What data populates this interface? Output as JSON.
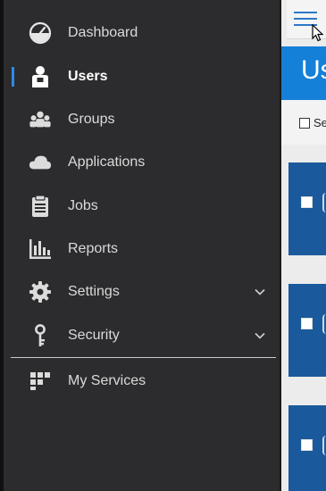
{
  "sidebar": {
    "items": [
      {
        "label": "Dashboard",
        "icon": "dashboard-icon"
      },
      {
        "label": "Users",
        "icon": "user-icon",
        "active": true
      },
      {
        "label": "Groups",
        "icon": "groups-icon"
      },
      {
        "label": "Applications",
        "icon": "cloud-icon"
      },
      {
        "label": "Jobs",
        "icon": "clipboard-icon"
      },
      {
        "label": "Reports",
        "icon": "bar-chart-icon"
      },
      {
        "label": "Settings",
        "icon": "gear-icon",
        "expandable": true
      },
      {
        "label": "Security",
        "icon": "key-icon",
        "expandable": true
      },
      {
        "label": "My Services",
        "icon": "grid-icon"
      }
    ]
  },
  "content": {
    "title": "Us",
    "select_label": "Se"
  },
  "colors": {
    "sidebar_bg": "#2c2c2e",
    "accent": "#2e8ae6",
    "title_bar": "#1480d8",
    "card_bg": "#1a5a9c"
  }
}
